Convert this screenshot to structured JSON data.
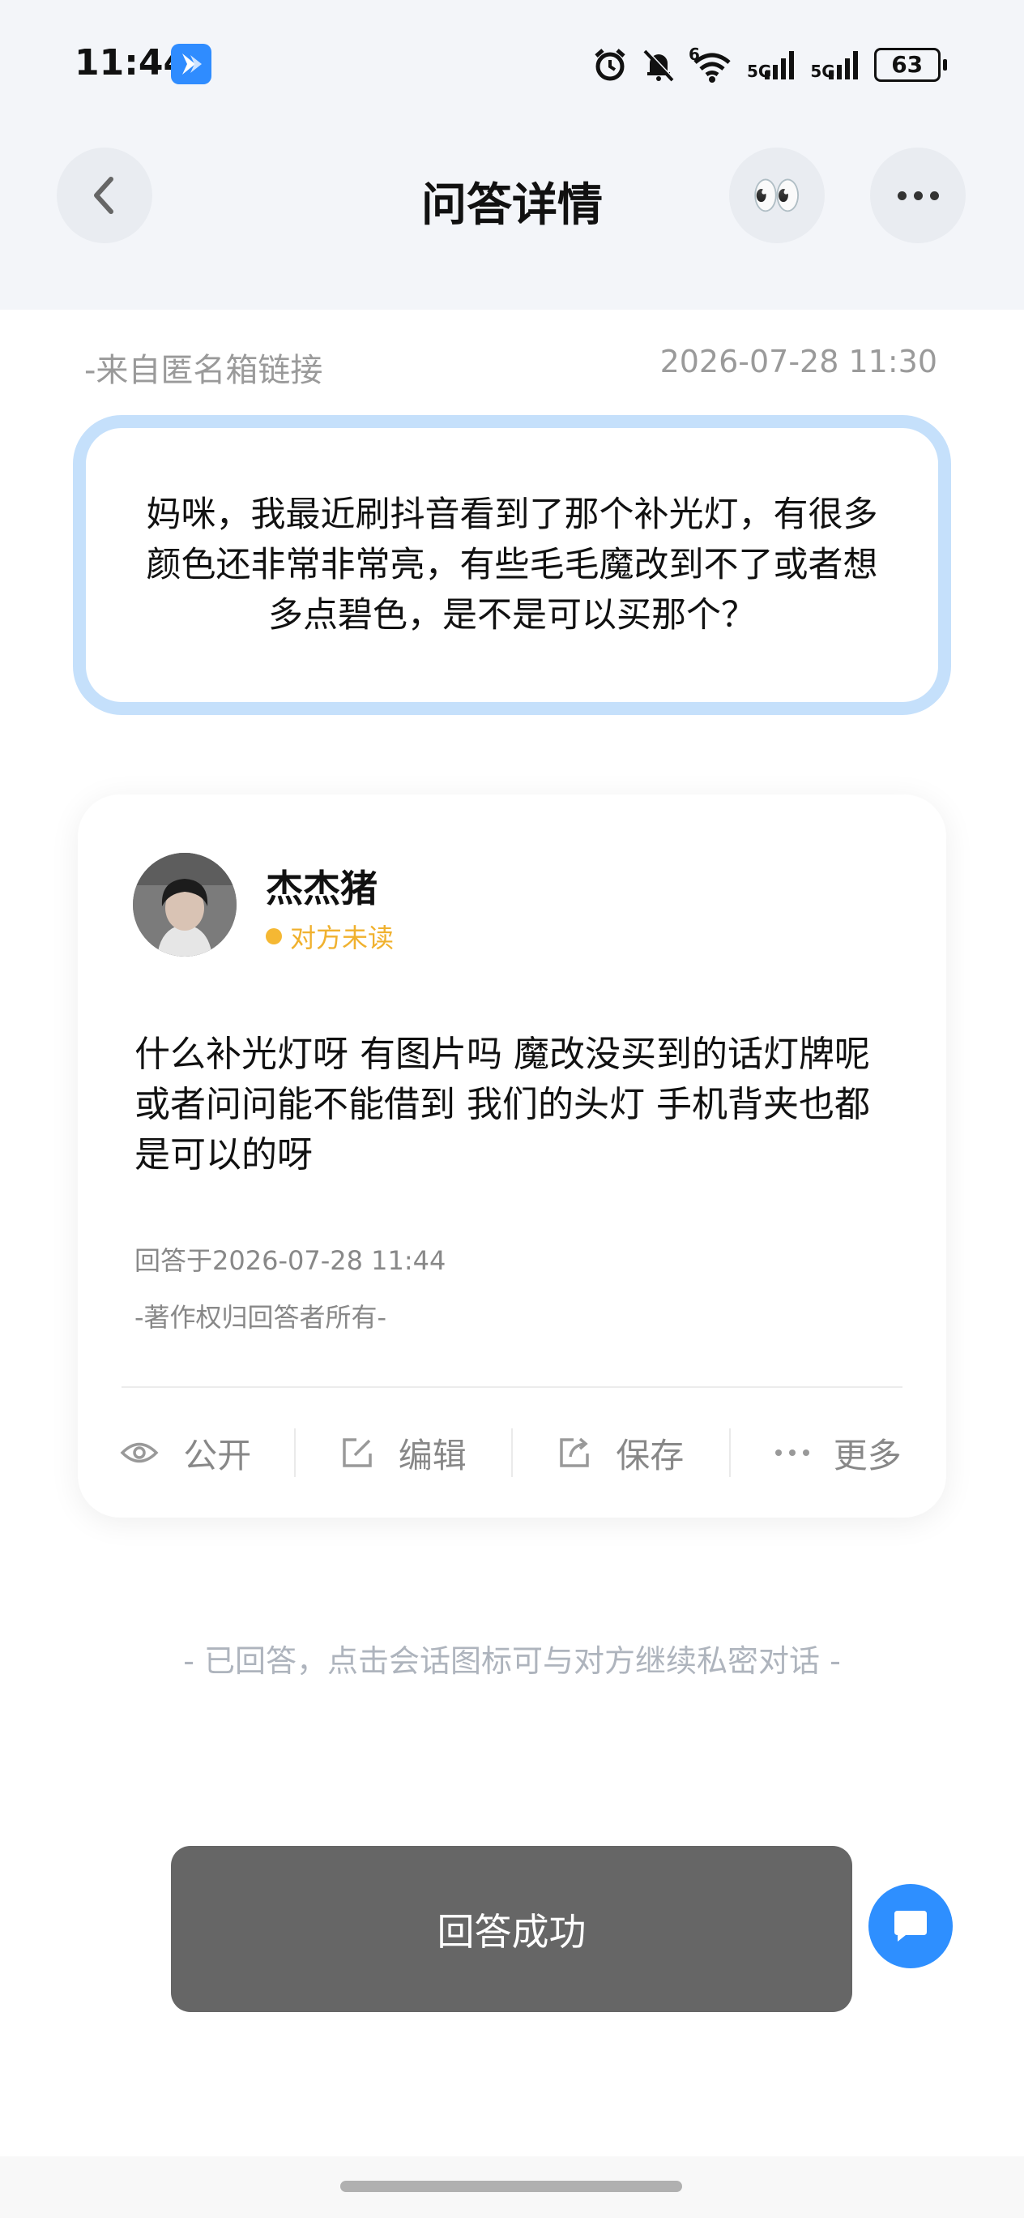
{
  "status_bar": {
    "time": "11:44",
    "network_1": "5G",
    "network_2": "5G",
    "wifi_index": "6",
    "battery": "63"
  },
  "nav": {
    "title": "问答详情",
    "eyes_emoji": "👀"
  },
  "question": {
    "source": "-来自匿名箱链接",
    "time": "2026-07-28 11:30",
    "text": "妈咪，我最近刷抖音看到了那个补光灯，有很多颜色还非常非常亮，有些毛毛魔改到不了或者想多点碧色，是不是可以买那个？"
  },
  "answer": {
    "username": "杰杰猪",
    "read_status": "对方未读",
    "text": "什么补光灯呀 有图片吗 魔改没买到的话灯牌呢 或者问问能不能借到 我们的头灯 手机背夹也都是可以的呀",
    "answered_at": "回答于2026-07-28 11:44",
    "copyright": "-著作权归回答者所有-",
    "actions": {
      "public": "公开",
      "edit": "编辑",
      "save": "保存",
      "more": "更多"
    }
  },
  "hint": "- 已回答，点击会话图标可与对方继续私密对话 -",
  "toast": "回答成功",
  "colors": {
    "accent_blue": "#2e8fff",
    "question_border": "#c5e0fb",
    "unread_yellow": "#f5b833",
    "toast_bg": "#666666"
  }
}
